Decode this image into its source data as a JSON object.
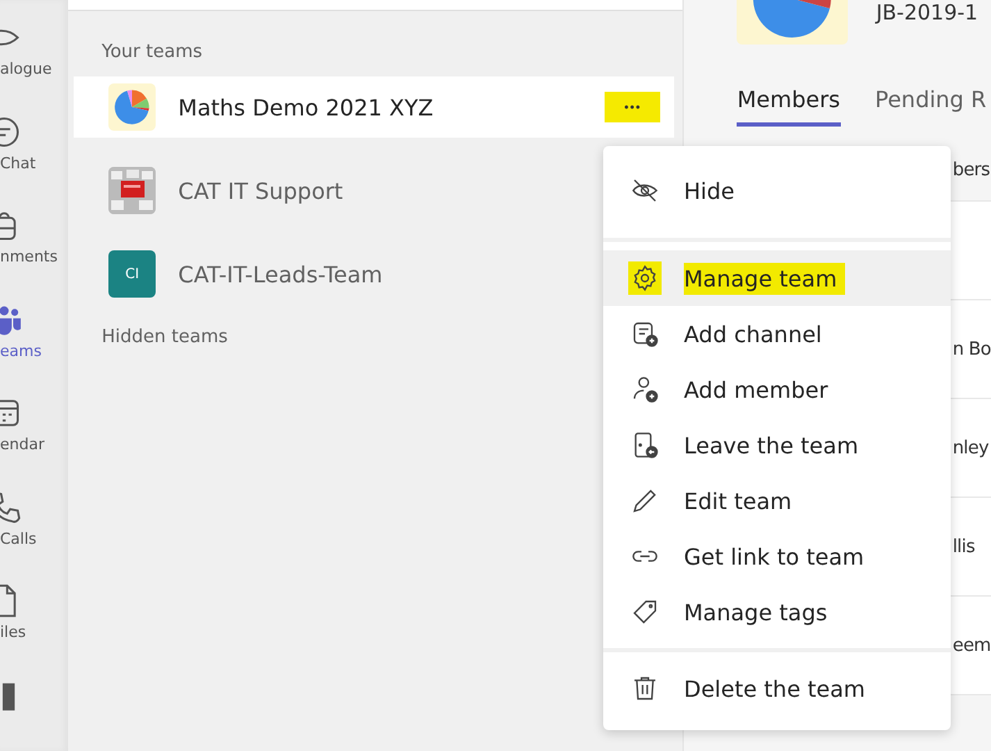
{
  "rail": [
    {
      "label": "alogue",
      "selected": false
    },
    {
      "label": "Chat",
      "selected": false
    },
    {
      "label": "nments",
      "selected": false
    },
    {
      "label": "eams",
      "selected": true
    },
    {
      "label": "endar",
      "selected": false
    },
    {
      "label": "Calls",
      "selected": false
    },
    {
      "label": "iles",
      "selected": false
    },
    {
      "selected": false
    }
  ],
  "sections": [
    {
      "title": "Your teams",
      "teams": [
        {
          "name": "Maths Demo 2021 XYZ",
          "avatar": {
            "kind": "pie"
          },
          "selected": true,
          "more": "•••",
          "highlighted": true
        },
        {
          "name": "CAT IT Support",
          "selected": false
        },
        {
          "name": "CAT-IT-Leads-Team",
          "avatar": {
            "kind": "initials",
            "text": "CI",
            "color": "#1b8383"
          },
          "selected": false
        }
      ]
    },
    {
      "title": "Hidden teams"
    }
  ],
  "detail": {
    "team_code": "JB-2019-1",
    "tabs": [
      {
        "label": "Members",
        "selected": true
      },
      {
        "label": "Pending R",
        "selected": false
      }
    ],
    "rows": [
      "bers",
      "",
      "n Bo",
      "nley",
      "llis",
      "eem"
    ]
  },
  "menu": {
    "groups": [
      [
        {
          "label": "Hide",
          "selected": false,
          "highlighted": false
        }
      ],
      [
        {
          "label": "Manage team",
          "selected": true,
          "highlighted": true
        },
        {
          "label": "Add channel",
          "selected": false,
          "highlighted": false
        },
        {
          "label": "Add member",
          "selected": false,
          "highlighted": false
        },
        {
          "label": "Leave the team",
          "selected": false,
          "highlighted": false
        },
        {
          "label": "Edit team",
          "selected": false,
          "highlighted": false
        },
        {
          "label": "Get link to team",
          "selected": false,
          "highlighted": false
        },
        {
          "label": "Manage tags",
          "selected": false,
          "highlighted": false
        }
      ],
      [
        {
          "label": "Delete the team",
          "selected": false,
          "highlighted": false
        }
      ]
    ]
  }
}
